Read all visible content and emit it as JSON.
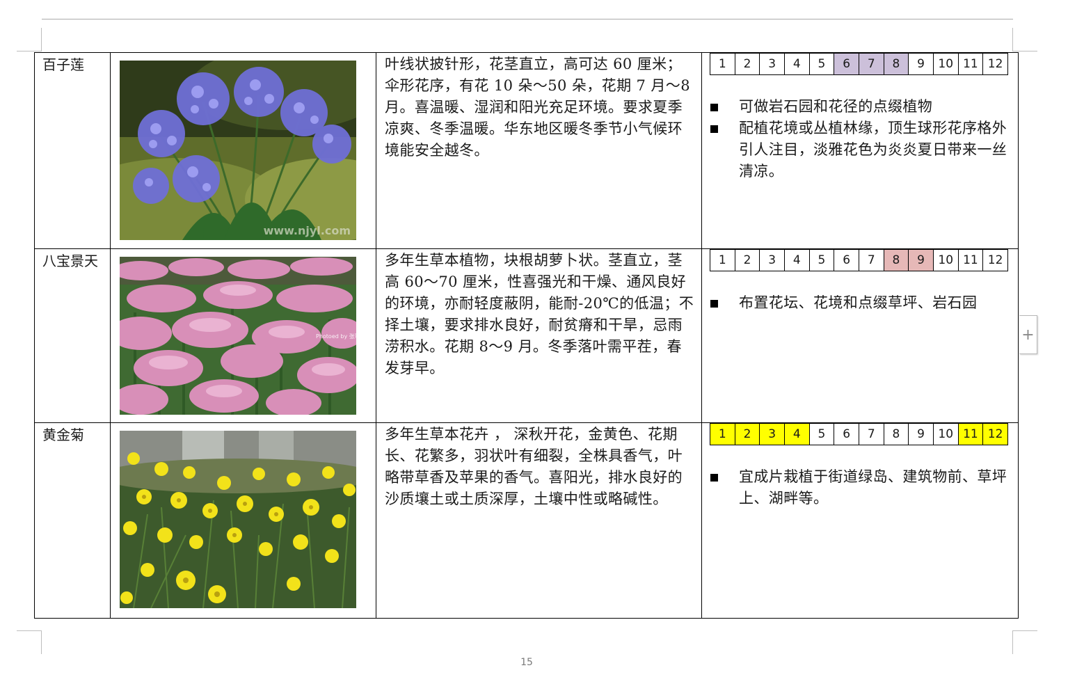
{
  "plants": [
    {
      "name": "百子莲",
      "description": "叶线状披针形，花茎直立，高可达 60 厘米；伞形花序，有花 10 朵～50 朵，花期 7 月～8 月。喜温暖、湿润和阳光充足环境。要求夏季凉爽、冬季温暖。华东地区暖冬季节小气候环境能安全越冬。",
      "months": [
        "1",
        "2",
        "3",
        "4",
        "5",
        "6",
        "7",
        "8",
        "9",
        "10",
        "11",
        "12"
      ],
      "highlight_months": [
        6,
        7,
        8
      ],
      "highlight_color": "#ccc0da",
      "uses": [
        "可做岩石园和花径的点缀植物",
        "配植花境或丛植林缘，顶生球形花序格外引人注目，淡雅花色为炎炎夏日带来一丝清凉。"
      ],
      "photo_watermark": "www.njyl.com"
    },
    {
      "name": "八宝景天",
      "description": "多年生草本植物，块根胡萝卜状。茎直立，茎高 60～70 厘米，性喜强光和干燥、通风良好的环境，亦耐轻度蔽阴，能耐-20℃的低温；不择土壤，要求排水良好，耐贫瘠和干旱，忌雨涝积水。花期 8～9 月。冬季落叶需平茬，春发芽早。",
      "months": [
        "1",
        "2",
        "3",
        "4",
        "5",
        "6",
        "7",
        "8",
        "9",
        "10",
        "11",
        "12"
      ],
      "highlight_months": [
        8,
        9
      ],
      "highlight_color": "#e6b8b7",
      "uses": [
        "布置花坛、花境和点缀草坪、岩石园"
      ],
      "photo_watermark": "Photoed by 张骞"
    },
    {
      "name": "黄金菊",
      "description": "多年生草本花卉 ， 深秋开花，金黄色、花期长、花繁多，羽状叶有细裂，全株具香气，叶略带草香及苹果的香气。喜阳光，排水良好的沙质壤土或土质深厚，土壤中性或略碱性。",
      "months": [
        "1",
        "2",
        "3",
        "4",
        "5",
        "6",
        "7",
        "8",
        "9",
        "10",
        "11",
        "12"
      ],
      "highlight_months": [
        1,
        2,
        3,
        4,
        11,
        12
      ],
      "highlight_color": "#ffff00",
      "uses": [
        "宜成片栽植于街道绿岛、建筑物前、草坪上、湖畔等。"
      ],
      "photo_watermark": ""
    }
  ],
  "page_number": "15",
  "side_tab_glyph": "+"
}
